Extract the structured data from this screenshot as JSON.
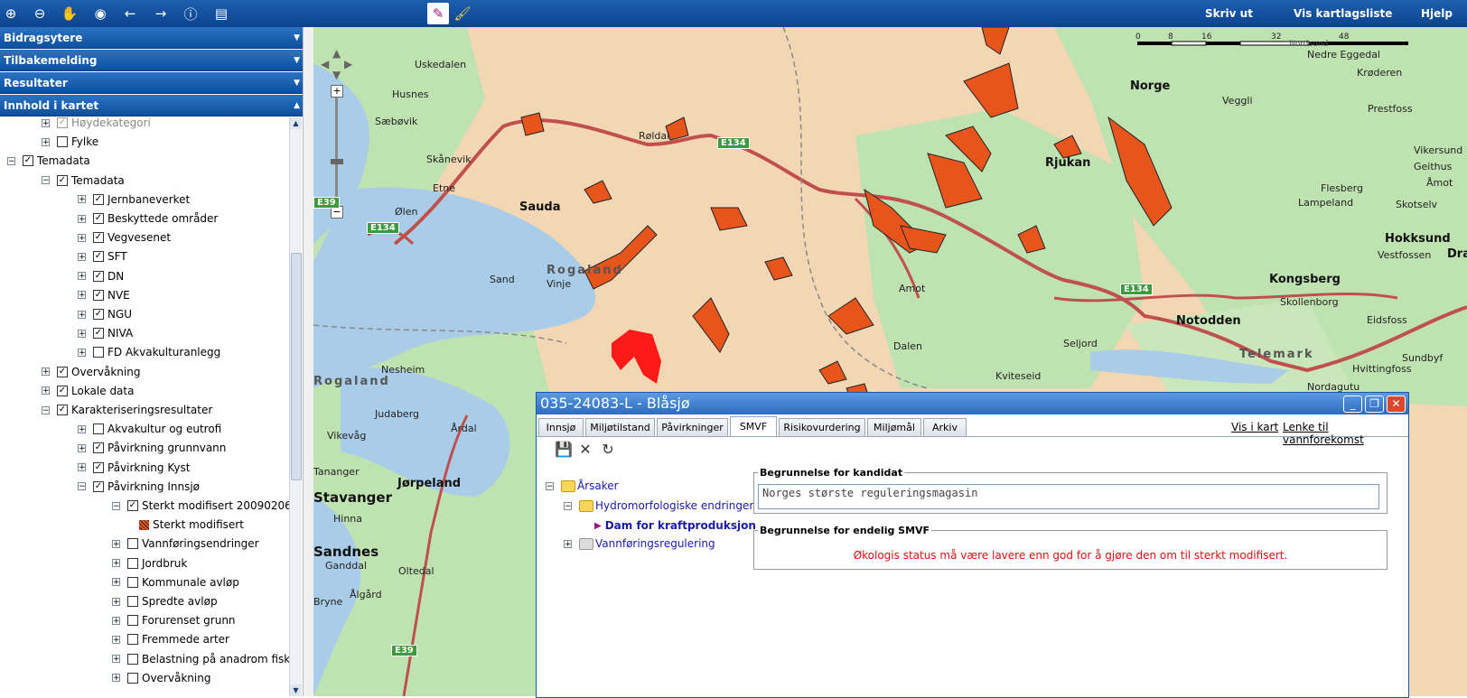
{
  "toolbar": {
    "icons": [
      "zoom-in-icon",
      "zoom-out-icon",
      "pan-hand-icon",
      "globe-icon",
      "back-arrow-icon",
      "forward-arrow-icon",
      "info-icon",
      "layers-icon",
      "draw-select-icon",
      "paintbrush-icon"
    ],
    "print_label": "Skriv ut",
    "layerlist_label": "Vis kartlagsliste",
    "help_label": "Hjelp"
  },
  "accordion": [
    "Bidragsytere",
    "Tilbakemelding",
    "Resultater",
    "Innhold i kartet"
  ],
  "tree": [
    {
      "label": "Høydekategori",
      "level": 1,
      "expander": "+",
      "checked": true,
      "gray": true
    },
    {
      "label": "Fylke",
      "level": 1,
      "expander": "+",
      "checked": false
    },
    {
      "label": "Temadata",
      "level": 0,
      "expander": "−",
      "checked": true
    },
    {
      "label": "Temadata",
      "level": 1,
      "expander": "−",
      "checked": true
    },
    {
      "label": "Jernbaneverket",
      "level": 2,
      "expander": "+",
      "checked": true
    },
    {
      "label": "Beskyttede områder",
      "level": 2,
      "expander": "+",
      "checked": true
    },
    {
      "label": "Vegvesenet",
      "level": 2,
      "expander": "+",
      "checked": true
    },
    {
      "label": "SFT",
      "level": 2,
      "expander": "+",
      "checked": true
    },
    {
      "label": "DN",
      "level": 2,
      "expander": "+",
      "checked": true
    },
    {
      "label": "NVE",
      "level": 2,
      "expander": "+",
      "checked": true
    },
    {
      "label": "NGU",
      "level": 2,
      "expander": "+",
      "checked": true
    },
    {
      "label": "NIVA",
      "level": 2,
      "expander": "+",
      "checked": true
    },
    {
      "label": "FD Akvakulturanlegg",
      "level": 2,
      "expander": "+",
      "checked": false
    },
    {
      "label": "Overvåkning",
      "level": 1,
      "expander": "+",
      "checked": true
    },
    {
      "label": "Lokale data",
      "level": 1,
      "expander": "+",
      "checked": true
    },
    {
      "label": "Karakteriseringsresultater",
      "level": 1,
      "expander": "−",
      "checked": true
    },
    {
      "label": "Akvakultur og eutrofi",
      "level": 2,
      "expander": "+",
      "checked": false
    },
    {
      "label": "Påvirkning grunnvann",
      "level": 2,
      "expander": "+",
      "checked": true
    },
    {
      "label": "Påvirkning Kyst",
      "level": 2,
      "expander": "+",
      "checked": true
    },
    {
      "label": "Påvirkning Innsjø",
      "level": 2,
      "expander": "−",
      "checked": true
    },
    {
      "label": "Sterkt modifisert 20090206",
      "level": 3,
      "expander": "−",
      "checked": true
    },
    {
      "label": "Sterkt modifisert",
      "level": 4,
      "legend": true
    },
    {
      "label": "Vannføringsendringer",
      "level": 3,
      "expander": "+",
      "checked": false
    },
    {
      "label": "Jordbruk",
      "level": 3,
      "expander": "+",
      "checked": false
    },
    {
      "label": "Kommunale avløp",
      "level": 3,
      "expander": "+",
      "checked": false
    },
    {
      "label": "Spredte avløp",
      "level": 3,
      "expander": "+",
      "checked": false
    },
    {
      "label": "Forurenset grunn",
      "level": 3,
      "expander": "+",
      "checked": false
    },
    {
      "label": "Fremmede arter",
      "level": 3,
      "expander": "+",
      "checked": false
    },
    {
      "label": "Belastning på anadrom fisk",
      "level": 3,
      "expander": "+",
      "checked": false
    },
    {
      "label": "Overvåkning",
      "level": 3,
      "expander": "+",
      "checked": false
    }
  ],
  "map": {
    "scale_labels": [
      "0",
      "8",
      "16",
      "32",
      "48"
    ],
    "scale_unit": "Nordsund",
    "places": [
      {
        "name": "Uskedalen",
        "big": false
      },
      {
        "name": "Husnes",
        "big": false
      },
      {
        "name": "Sæbøvik",
        "big": false
      },
      {
        "name": "Skånevik",
        "big": false
      },
      {
        "name": "Etne",
        "big": false
      },
      {
        "name": "Ølen",
        "big": false
      },
      {
        "name": "Sauda",
        "big": true
      },
      {
        "name": "Røldal",
        "big": false
      },
      {
        "name": "Rjukan",
        "big": true
      },
      {
        "name": "Norge",
        "big": true
      },
      {
        "name": "Veggli",
        "big": false
      },
      {
        "name": "Nedre Eggedal",
        "big": false
      },
      {
        "name": "Krøderen",
        "big": false
      },
      {
        "name": "Prestfoss",
        "big": false
      },
      {
        "name": "Vikersund",
        "big": false
      },
      {
        "name": "Geithus",
        "big": false
      },
      {
        "name": "Åmot",
        "big": false
      },
      {
        "name": "Flesberg",
        "big": false
      },
      {
        "name": "Lampeland",
        "big": false
      },
      {
        "name": "Skotselv",
        "big": false
      },
      {
        "name": "Hokksund",
        "big": true
      },
      {
        "name": "Vestfossen",
        "big": false
      },
      {
        "name": "Kongsberg",
        "big": true
      },
      {
        "name": "Skollenborg",
        "big": false
      },
      {
        "name": "Notodden",
        "big": true
      },
      {
        "name": "Eidsfoss",
        "big": false
      },
      {
        "name": "Hvittingfoss",
        "big": false
      },
      {
        "name": "Sundbyf",
        "big": false
      },
      {
        "name": "Nordagutu",
        "big": false
      },
      {
        "name": "Seljord",
        "big": false
      },
      {
        "name": "Kviteseid",
        "big": false
      },
      {
        "name": "Dalen",
        "big": false
      },
      {
        "name": "Amot",
        "big": false
      },
      {
        "name": "Sand",
        "big": false
      },
      {
        "name": "Vinje",
        "big": false
      },
      {
        "name": "Nesheim",
        "big": false
      },
      {
        "name": "Judaberg",
        "big": false
      },
      {
        "name": "Vikevåg",
        "big": false
      },
      {
        "name": "Jørpeland",
        "big": true
      },
      {
        "name": "Årdal",
        "big": false
      },
      {
        "name": "Stavanger",
        "big": true
      },
      {
        "name": "Hinna",
        "big": false
      },
      {
        "name": "Sandnes",
        "big": true
      },
      {
        "name": "Ganddal",
        "big": false
      },
      {
        "name": "Ålgård",
        "big": false
      },
      {
        "name": "Oltedal",
        "big": false
      },
      {
        "name": "Bryne",
        "big": false
      },
      {
        "name": "Dra",
        "big": true
      },
      {
        "name": "Tananger",
        "big": false
      }
    ],
    "regions": [
      "Rogaland",
      "Rogaland",
      "Telemark"
    ],
    "shields": [
      "E134",
      "E134",
      "E134",
      "E39",
      "E39"
    ]
  },
  "dialog": {
    "title": "035-24083-L - Blåsjø",
    "tabs": [
      "Innsjø",
      "Miljøtilstand",
      "Påvirkninger",
      "SMVF",
      "Risikovurdering",
      "Miljømål",
      "Arkiv"
    ],
    "active_tab": "SMVF",
    "link_show_map": "Vis i kart",
    "link_to_waterbody": "Lenke til vannforekomst",
    "tools": [
      "save-icon",
      "delete-icon",
      "refresh-icon"
    ],
    "tree": {
      "root": "Årsaker",
      "child1": "Hydromorfologiske endringer",
      "leaf": "Dam for kraftproduksjon",
      "child2": "Vannføringsregulering"
    },
    "candidate_legend": "Begrunnelse for kandidat",
    "candidate_text": "Norges største reguleringsmagasin",
    "final_legend": "Begrunnelse for endelig SMVF",
    "final_text": "Økologis status må være lavere enn god for å gjøre den om til sterkt modifisert."
  },
  "colors": {
    "toolbar": "#1d5fae",
    "map_land": "#f3d6b3",
    "map_water": "#a9cde8",
    "map_forest": "#bfe3b0",
    "hms_fill": "#e8551c",
    "road": "#c0504d"
  }
}
